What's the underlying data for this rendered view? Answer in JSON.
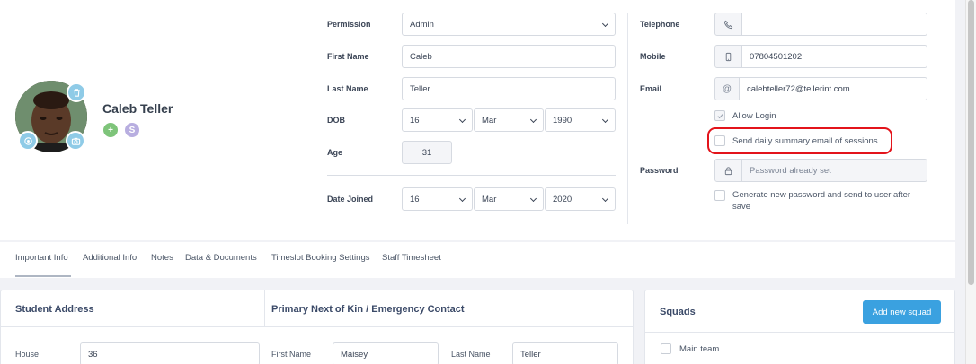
{
  "profile": {
    "name": "Caleb Teller"
  },
  "form": {
    "permission": {
      "label": "Permission",
      "value": "Admin"
    },
    "first_name": {
      "label": "First Name",
      "value": "Caleb"
    },
    "last_name": {
      "label": "Last Name",
      "value": "Teller"
    },
    "dob": {
      "label": "DOB",
      "day": "16",
      "month": "Mar",
      "year": "1990"
    },
    "age": {
      "label": "Age",
      "value": "31"
    },
    "date_joined": {
      "label": "Date Joined",
      "day": "16",
      "month": "Mar",
      "year": "2020"
    },
    "telephone": {
      "label": "Telephone",
      "value": ""
    },
    "mobile": {
      "label": "Mobile",
      "value": "07804501202"
    },
    "email": {
      "label": "Email",
      "addon": "@",
      "value": "calebteller72@tellerint.com"
    },
    "allow_login": {
      "label": "Allow Login",
      "checked": true
    },
    "daily_summary": {
      "label": "Send daily summary email of sessions",
      "checked": false
    },
    "password": {
      "label": "Password",
      "placeholder": "Password already set"
    },
    "generate_password": {
      "label": "Generate new password and send to user after save",
      "checked": false
    }
  },
  "tabs": [
    "Important Info",
    "Additional Info",
    "Notes",
    "Data & Documents",
    "Timeslot Booking Settings",
    "Staff Timesheet"
  ],
  "address_panel": {
    "student_address_title": "Student Address",
    "kin_title": "Primary Next of Kin / Emergency Contact",
    "house": {
      "label": "House",
      "value": "36"
    },
    "kin_first_name": {
      "label": "First Name",
      "value": "Maisey"
    },
    "kin_last_name": {
      "label": "Last Name",
      "value": "Teller"
    }
  },
  "squads": {
    "title": "Squads",
    "add_button": "Add new squad",
    "items": [
      {
        "label": "Main team",
        "checked": false
      }
    ]
  },
  "colors": {
    "accent": "#3aa1e0",
    "highlight": "#e3141b",
    "avatar_button": "#8fcbe7",
    "add_green": "#7ec47a",
    "s_badge": "#b8aee0"
  }
}
